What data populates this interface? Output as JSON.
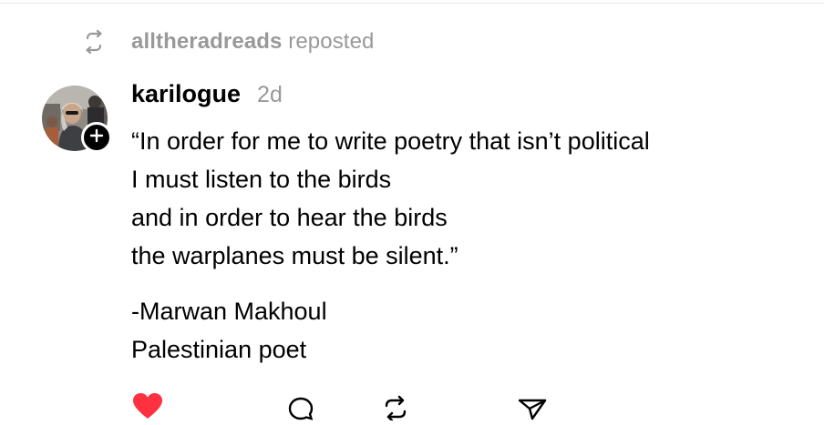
{
  "repost": {
    "icon": "repost-icon",
    "username": "alltheradreads",
    "label": "reposted"
  },
  "post": {
    "avatar": "avatar",
    "follow_icon": "plus-icon",
    "username": "karilogue",
    "timestamp": "2d",
    "lines": [
      "“In order for me to write poetry that isn’t political",
      "I must listen to the birds",
      "and in order to hear the birds",
      "the warplanes must be silent.”"
    ],
    "attribution": [
      "-Marwan Makhoul",
      "Palestinian poet"
    ]
  },
  "actions": {
    "like_icon": "heart-icon",
    "liked": true,
    "like_color": "#ff3040",
    "reply_icon": "comment-icon",
    "repost_icon": "repost-icon",
    "share_icon": "share-icon"
  }
}
